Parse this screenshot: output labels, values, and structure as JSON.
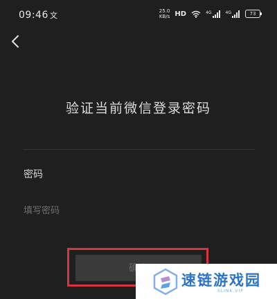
{
  "status_bar": {
    "time": "09:46",
    "notification_glyph": "文",
    "net_speed_value": "25.0",
    "net_speed_unit": "KB/s",
    "hd_label": "HD",
    "signal_1_label": "4G",
    "signal_2_label": "4G",
    "battery_level": "73"
  },
  "page": {
    "title": "验证当前微信登录密码",
    "password_label": "密码",
    "password_placeholder": "填写密码",
    "password_value": "",
    "confirm_button_label": "确定"
  },
  "watermark": {
    "text": "速链游戏园",
    "subtext": "SLINK.VIP"
  },
  "colors": {
    "background": "#1f1f1f",
    "highlight": "#d8353d",
    "button_bg": "#3a3a3a",
    "watermark_blue": "#2a73c9"
  },
  "icons": {
    "back": "chevron-left-icon",
    "wifi": "wifi-icon",
    "signal": "cell-signal-icon",
    "battery": "battery-icon",
    "watermark_logo": "link-logo-icon"
  }
}
